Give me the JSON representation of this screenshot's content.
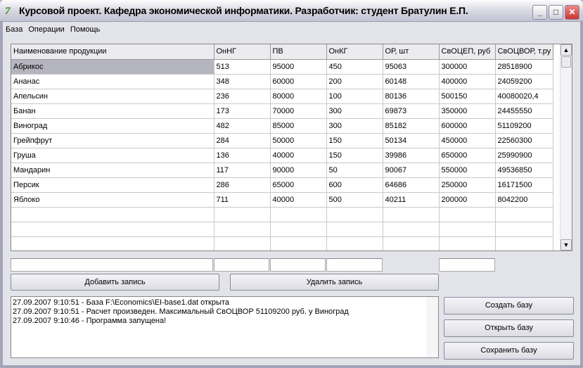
{
  "window": {
    "title": "Курсовой проект. Кафедра экономической информатики. Разработчик: студент Братулин Е.П."
  },
  "menu": [
    "База",
    "Операции",
    "Помощь"
  ],
  "table": {
    "columns": [
      "Наименование продукции",
      "ОнНГ",
      "ПВ",
      "ОнКГ",
      "ОР, шт",
      "СвОЦЕП, руб",
      "СвОЦВОР, т.ру"
    ],
    "rows": [
      [
        "Абрикос",
        "513",
        "95000",
        "450",
        "95063",
        "300000",
        "28518900"
      ],
      [
        "Ананас",
        "348",
        "60000",
        "200",
        "60148",
        "400000",
        "24059200"
      ],
      [
        "Апельсин",
        "236",
        "80000",
        "100",
        "80136",
        "500150",
        "40080020,4"
      ],
      [
        "Банан",
        "173",
        "70000",
        "300",
        "69873",
        "350000",
        "24455550"
      ],
      [
        "Виноград",
        "482",
        "85000",
        "300",
        "85182",
        "600000",
        "51109200"
      ],
      [
        "Грейпфрут",
        "284",
        "50000",
        "150",
        "50134",
        "450000",
        "22560300"
      ],
      [
        "Груша",
        "136",
        "40000",
        "150",
        "39986",
        "650000",
        "25990900"
      ],
      [
        "Мандарин",
        "117",
        "90000",
        "50",
        "90067",
        "550000",
        "49536850"
      ],
      [
        "Персик",
        "286",
        "65000",
        "600",
        "64686",
        "250000",
        "16171500"
      ],
      [
        "Яблоко",
        "711",
        "40000",
        "500",
        "40211",
        "200000",
        "8042200"
      ]
    ]
  },
  "buttons": {
    "add": "Добавить запись",
    "delete": "Удалить запись",
    "create": "Создать базу",
    "open": "Открыть базу",
    "save": "Сохранить базу"
  },
  "log": [
    "27.09.2007 9:10:51 - База F:\\Economics\\EI-base1.dat открыта",
    "27.09.2007 9:10:51 - Расчет произведен. Максимальный СвОЦВОР 51109200 руб. у Виноград",
    "27.09.2007 9:10:46 - Программа запущена!"
  ]
}
